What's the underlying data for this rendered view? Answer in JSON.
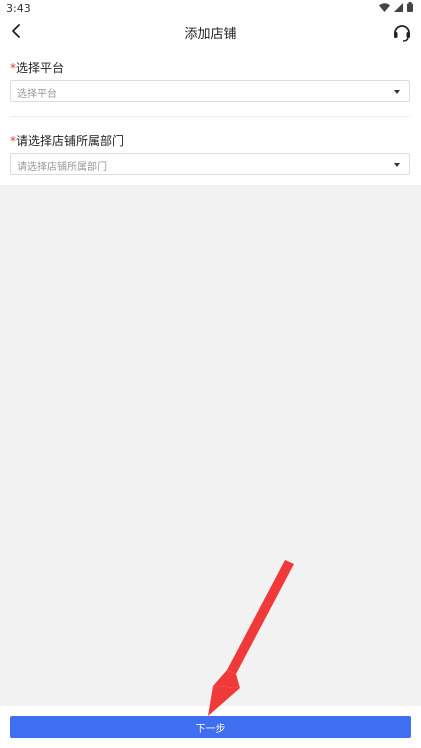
{
  "status_bar": {
    "time": "3:43"
  },
  "header": {
    "title": "添加店铺",
    "back_icon": "chevron-left-icon",
    "support_icon": "headset-icon"
  },
  "form": {
    "platform": {
      "required_mark": "*",
      "label": "选择平台",
      "placeholder": "选择平台"
    },
    "department": {
      "required_mark": "*",
      "label": "请选择店铺所属部门",
      "placeholder": "请选择店铺所属部门"
    }
  },
  "footer": {
    "next_label": "下一步"
  },
  "colors": {
    "accent": "#3f6ef0",
    "required": "#e53935",
    "arrow": "#f03a3a"
  }
}
